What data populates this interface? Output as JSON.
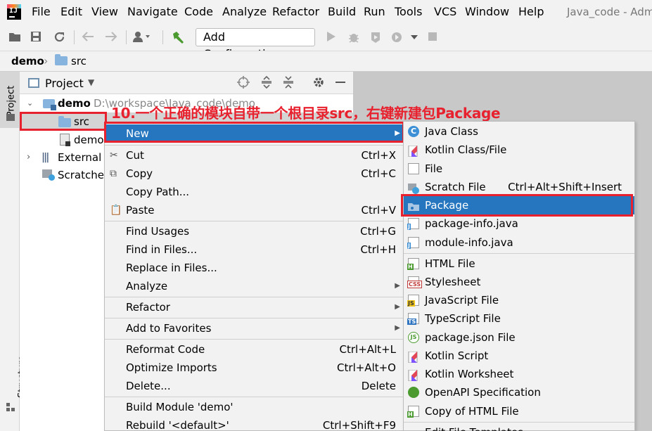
{
  "menubar": {
    "items": [
      "File",
      "Edit",
      "View",
      "Navigate",
      "Code",
      "Analyze",
      "Refactor",
      "Build",
      "Run",
      "Tools",
      "VCS",
      "Window",
      "Help"
    ],
    "window_title": "Java_code - Adm"
  },
  "app": {
    "logo_text": "IJ"
  },
  "toolbar": {
    "run_config": "Add Configuration..."
  },
  "breadcrumb": {
    "root": "demo",
    "child": "src"
  },
  "left_strip": {
    "project_tab": "Project",
    "structure_tab": "Structure"
  },
  "project_panel": {
    "header": "Project",
    "tree": {
      "demo_name": "demo",
      "demo_path": "D:\\workspace\\Java_code\\demo",
      "src": "src",
      "demo_iml": "demo",
      "external_libraries": "External L",
      "scratches": "Scratches"
    }
  },
  "annotation": {
    "text": "10.一个正确的模块自带一个根目录src，右键新建包Package",
    "color": "#e8212e"
  },
  "context_menu": {
    "new": {
      "label": "New"
    },
    "cut": {
      "label": "Cut",
      "shortcut": "Ctrl+X"
    },
    "copy": {
      "label": "Copy",
      "shortcut": "Ctrl+C"
    },
    "copy_path": {
      "label": "Copy Path..."
    },
    "paste": {
      "label": "Paste",
      "shortcut": "Ctrl+V"
    },
    "find_usages": {
      "label": "Find Usages",
      "shortcut": "Ctrl+G"
    },
    "find_in_files": {
      "label": "Find in Files...",
      "shortcut": "Ctrl+H"
    },
    "replace_in_files": {
      "label": "Replace in Files..."
    },
    "analyze": {
      "label": "Analyze"
    },
    "refactor": {
      "label": "Refactor"
    },
    "add_to_favorites": {
      "label": "Add to Favorites"
    },
    "reformat_code": {
      "label": "Reformat Code",
      "shortcut": "Ctrl+Alt+L"
    },
    "optimize_imports": {
      "label": "Optimize Imports",
      "shortcut": "Ctrl+Alt+O"
    },
    "delete": {
      "label": "Delete...",
      "shortcut": "Delete"
    },
    "build_module": {
      "label": "Build Module 'demo'"
    },
    "rebuild": {
      "label": "Rebuild '<default>'",
      "shortcut": "Ctrl+Shift+F9"
    }
  },
  "submenu": {
    "java_class": {
      "label": "Java Class"
    },
    "kotlin_class": {
      "label": "Kotlin Class/File"
    },
    "file": {
      "label": "File"
    },
    "scratch_file": {
      "label": "Scratch File",
      "shortcut": "Ctrl+Alt+Shift+Insert"
    },
    "package": {
      "label": "Package"
    },
    "package_info": {
      "label": "package-info.java"
    },
    "module_info": {
      "label": "module-info.java"
    },
    "html_file": {
      "label": "HTML File"
    },
    "stylesheet": {
      "label": "Stylesheet"
    },
    "javascript_file": {
      "label": "JavaScript File"
    },
    "typescript_file": {
      "label": "TypeScript File"
    },
    "package_json": {
      "label": "package.json File"
    },
    "kotlin_script": {
      "label": "Kotlin Script"
    },
    "kotlin_worksheet": {
      "label": "Kotlin Worksheet"
    },
    "openapi": {
      "label": "OpenAPI Specification"
    },
    "copy_html": {
      "label": "Copy of HTML File"
    },
    "edit_templates": {
      "label": "Edit File Templates..."
    }
  },
  "icons": {
    "badges": {
      "css": "CSS",
      "js": "JS",
      "ts": "TS",
      "json": "JS",
      "html": "H",
      "java": "J"
    }
  },
  "colors": {
    "selection": "#2675bf",
    "annotation": "#e8212e",
    "folder": "#87b4de"
  }
}
